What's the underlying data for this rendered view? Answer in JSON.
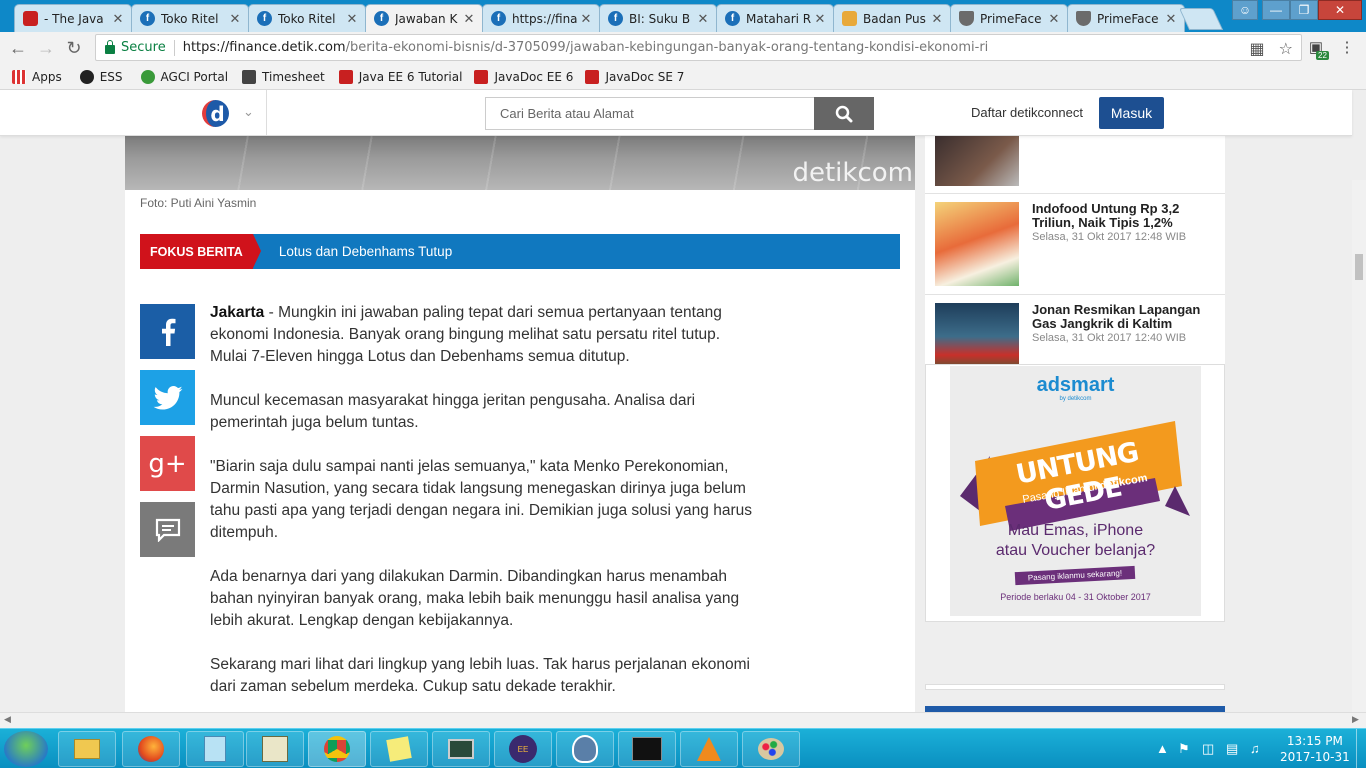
{
  "browser": {
    "tabs": [
      {
        "title": "- The Java",
        "icon": "oracle"
      },
      {
        "title": "Toko Ritel",
        "icon": "fb"
      },
      {
        "title": "Toko Ritel",
        "icon": "fb"
      },
      {
        "title": "Jawaban K",
        "icon": "fb",
        "active": true
      },
      {
        "title": "https://fina",
        "icon": "fb"
      },
      {
        "title": "BI: Suku B",
        "icon": "fb"
      },
      {
        "title": "Matahari R",
        "icon": "fb"
      },
      {
        "title": "Badan Pus",
        "icon": "map"
      },
      {
        "title": "PrimeFace",
        "icon": "shield"
      },
      {
        "title": "PrimeFace",
        "icon": "shield"
      }
    ],
    "secure_label": "Secure",
    "url_host": "https://finance.detik.com",
    "url_path": "/berita-ekonomi-bisnis/d-3705099/jawaban-kebingungan-banyak-orang-tentang-kondisi-ekonomi-ri",
    "ext_badge": "22",
    "bookmarks": [
      "Apps",
      "ESS",
      "AGCI Portal",
      "Timesheet",
      "Java EE 6 Tutorial",
      "JavaDoc EE 6",
      "JavaDoc SE 7"
    ]
  },
  "header": {
    "logo": "d",
    "search_placeholder": "Cari Berita atau Alamat",
    "register": "Daftar detikconnect",
    "login": "Masuk"
  },
  "article": {
    "watermark": "detikcom",
    "photo_caption": "Foto: Puti Aini Yasmin",
    "focus_label": "FOKUS BERITA",
    "focus_topic": "Lotus dan Debenhams Tutup",
    "lead_city": "Jakarta",
    "p1": " - Mungkin ini jawaban paling tepat dari semua pertanyaan tentang ekonomi Indonesia. Banyak orang bingung melihat satu persatu ritel tutup. Mulai 7-Eleven hingga Lotus dan Debenhams semua ditutup.",
    "p2": "Muncul kecemasan masyarakat hingga jeritan pengusaha. Analisa dari pemerintah juga belum tuntas.",
    "p3": "\"Biarin saja dulu sampai nanti jelas semuanya,\" kata Menko Perekonomian, Darmin Nasution, yang secara tidak langsung menegaskan dirinya juga belum tahu pasti apa yang terjadi dengan negara ini. Demikian juga solusi yang harus ditempuh.",
    "p4": "Ada benarnya dari yang dilakukan Darmin. Dibandingkan harus menambah bahan nyinyiran banyak orang, maka lebih baik menunggu hasil analisa yang lebih akurat. Lengkap dengan kebijakannya.",
    "p5": "Sekarang mari lihat dari lingkup yang lebih luas. Tak harus perjalanan ekonomi dari zaman sebelum merdeka. Cukup satu dekade terakhir."
  },
  "sidebar": {
    "news": [
      {
        "title": "Indofood Untung Rp 3,2 Triliun, Naik Tipis 1,2%",
        "date": "Selasa, 31 Okt 2017 12:48 WIB"
      },
      {
        "title": "Jonan Resmikan Lapangan Gas Jangkrik di Kaltim",
        "date": "Selasa, 31 Okt 2017 12:40 WIB"
      }
    ],
    "ad": {
      "brand": "adsmart",
      "brand_by": "by detikcom",
      "headline": "UNTUNG GEDE",
      "sub_prefix": "Pasang Iklan di",
      "sub_brand": "detikcom",
      "line1": "Mau Emas, iPhone",
      "line2": "atau Voucher belanja?",
      "cta": "Pasang iklanmu sekarang!",
      "period": "Periode berlaku 04 - 31 Oktober 2017"
    }
  },
  "taskbar": {
    "time": "13:15 PM",
    "date": "2017-10-31"
  }
}
